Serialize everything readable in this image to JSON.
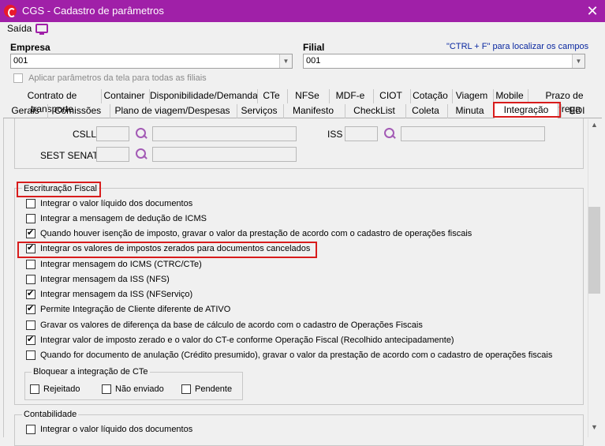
{
  "window": {
    "title": "CGS - Cadastro de parâmetros",
    "close": "✕"
  },
  "menu": {
    "saida": "Saída",
    "monitor_icon": "monitor-icon"
  },
  "empresa": {
    "label": "Empresa",
    "value": "001"
  },
  "filial": {
    "label": "Filial",
    "value": "001"
  },
  "hint": "\"CTRL + F\" para localizar os campos",
  "aplicar": {
    "label": "Aplicar parâmetros da tela para todas as filiais",
    "checked": false,
    "enabled": false
  },
  "tabs_row1": [
    "Contrato de transporte",
    "Container",
    "Disponibilidade/Demanda",
    "CTe",
    "NFSe",
    "MDF-e",
    "CIOT",
    "Cotação",
    "Viagem",
    "Mobile",
    "Prazo de entrega"
  ],
  "tabs_row2": [
    "Gerais",
    "Comissões",
    "Plano de viagem/Despesas",
    "Serviços",
    "Manifesto",
    "CheckList",
    "Coleta",
    "Minuta",
    "Integração",
    "EDI"
  ],
  "active_tab": "Integração",
  "impostos": {
    "csll": "CSLL",
    "iss": "ISS",
    "sest_senat": "SEST SENAT"
  },
  "escrituracao": {
    "title": "Escrituração Fiscal",
    "options": [
      {
        "label": "Integrar o valor líquido dos documentos",
        "checked": false
      },
      {
        "label": "Integrar a mensagem de dedução de ICMS",
        "checked": false
      },
      {
        "label": "Quando houver isenção de imposto, gravar o valor da prestação de acordo com o cadastro de operações fiscais",
        "checked": true
      },
      {
        "label": "Integrar os valores de impostos zerados para documentos cancelados",
        "checked": true
      },
      {
        "label": "Integrar mensagem do ICMS (CTRC/CTe)",
        "checked": false
      },
      {
        "label": "Integrar mensagem da ISS (NFS)",
        "checked": false
      },
      {
        "label": "Integrar mensagem da ISS (NFServiço)",
        "checked": true
      },
      {
        "label": "Permite Integração de Cliente diferente de ATIVO",
        "checked": true
      },
      {
        "label": "Gravar os valores de diferença da base de cálculo de acordo com o cadastro de Operações Fiscais",
        "checked": false
      },
      {
        "label": "Integrar valor de imposto zerado e o valor do CT-e conforme Operação Fiscal (Recolhido antecipadamente)",
        "checked": true
      },
      {
        "label": "Quando for documento de anulação (Crédito presumido), gravar o valor da prestação de acordo com o cadastro de operações fiscais",
        "checked": false
      }
    ],
    "bloquear": {
      "title": "Bloquear a integração de CTe",
      "options": [
        {
          "label": "Rejeitado",
          "checked": false
        },
        {
          "label": "Não enviado",
          "checked": false
        },
        {
          "label": "Pendente",
          "checked": false
        }
      ]
    }
  },
  "contabilidade": {
    "title": "Contabilidade",
    "options": [
      {
        "label": "Integrar o valor líquido dos documentos",
        "checked": false
      }
    ]
  },
  "colors": {
    "titlebar": "#a020a8",
    "highlight": "#d81c1c",
    "hint": "#0a28a0"
  }
}
